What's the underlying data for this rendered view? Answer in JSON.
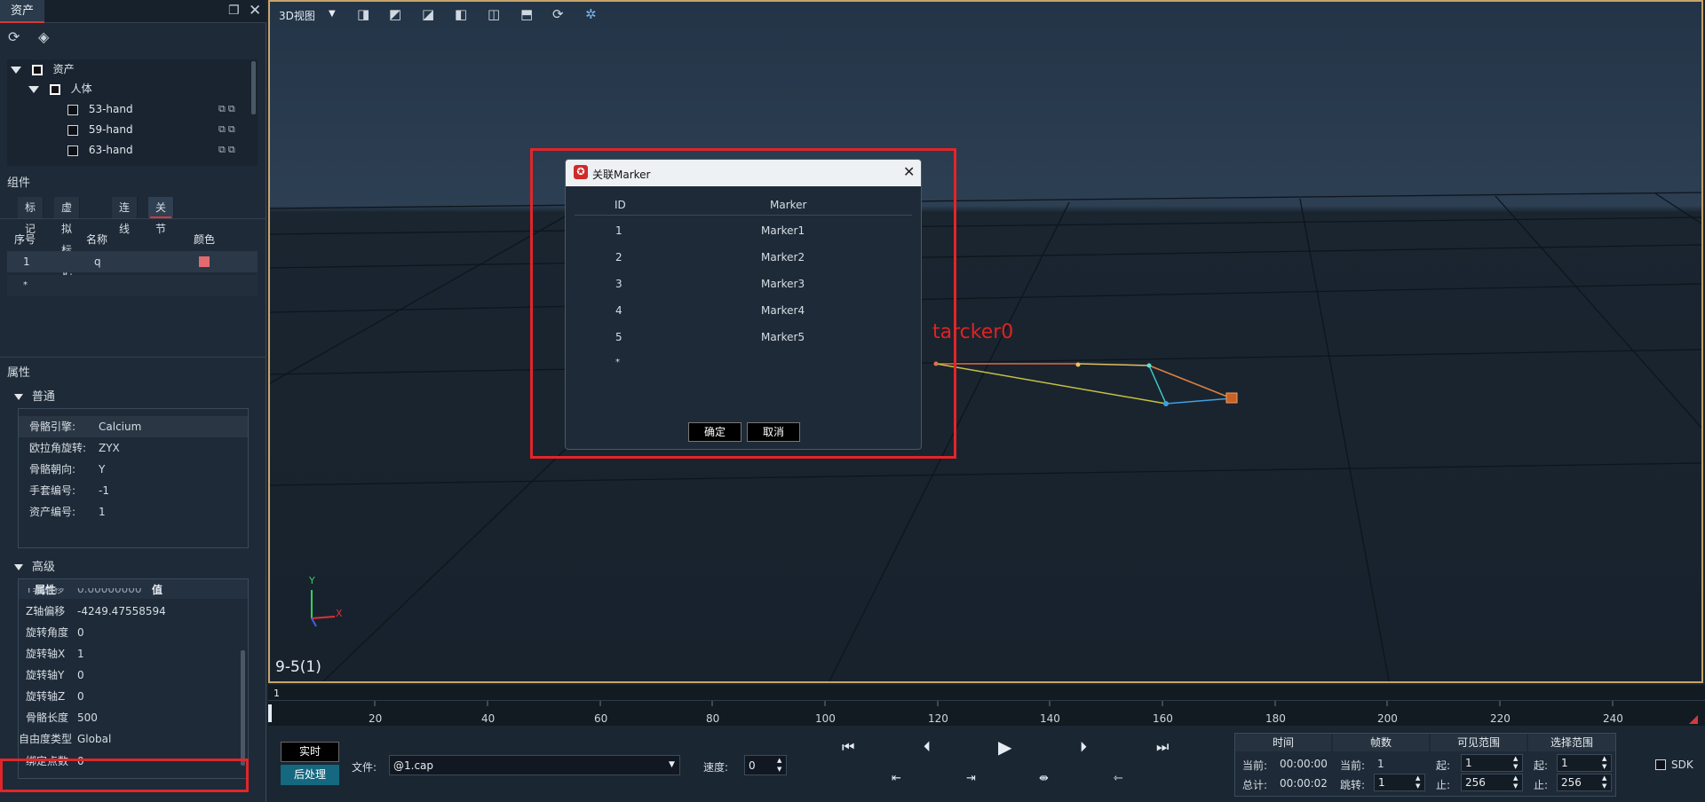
{
  "left_panel": {
    "tab_label": "资产",
    "tree": {
      "root": "资产",
      "group": "人体",
      "items": [
        "53-hand",
        "59-hand",
        "63-hand"
      ]
    },
    "components": {
      "title": "组件",
      "tabs": [
        "标记",
        "虚拟标记",
        "连线",
        "关节"
      ],
      "active_tab": "关节",
      "columns": [
        "序号",
        "名称",
        "颜色"
      ],
      "rows": [
        {
          "index": "1",
          "name": "q",
          "color": "#e46a6e"
        }
      ],
      "new_row_marker": "*"
    },
    "properties": {
      "title": "属性",
      "general_title": "普通",
      "general": [
        {
          "label": "骨骼引擎:",
          "value": "Calcium"
        },
        {
          "label": "欧拉角旋转:",
          "value": "ZYX"
        },
        {
          "label": "骨骼朝向:",
          "value": "Y"
        },
        {
          "label": "手套编号:",
          "value": "-1"
        },
        {
          "label": "资产编号:",
          "value": "1"
        }
      ],
      "advanced_title": "高级",
      "advanced_columns": [
        "属性",
        "值"
      ],
      "advanced_partial": {
        "label": "Y轴偏移",
        "value": "0.00000000"
      },
      "advanced": [
        {
          "label": "Z轴偏移",
          "value": "-4249.47558594"
        },
        {
          "label": "旋转角度",
          "value": "0"
        },
        {
          "label": "旋转轴X",
          "value": "1"
        },
        {
          "label": "旋转轴Y",
          "value": "0"
        },
        {
          "label": "旋转轴Z",
          "value": "0"
        },
        {
          "label": "骨骼长度",
          "value": "500"
        },
        {
          "label": "自由度类型",
          "value": "Global"
        },
        {
          "label": "绑定点数",
          "value": "0"
        }
      ]
    }
  },
  "viewport": {
    "view_mode": "3D视图",
    "tracker_label": "tarcker0",
    "frame_label": "9-5(1)",
    "axis_labels": {
      "x": "X",
      "y": "Y"
    }
  },
  "dialog": {
    "title": "关联Marker",
    "columns": [
      "ID",
      "Marker"
    ],
    "rows": [
      {
        "id": "1",
        "marker": "Marker1"
      },
      {
        "id": "2",
        "marker": "Marker2"
      },
      {
        "id": "3",
        "marker": "Marker3"
      },
      {
        "id": "4",
        "marker": "Marker4"
      },
      {
        "id": "5",
        "marker": "Marker5"
      }
    ],
    "new_row_marker": "*",
    "ok_label": "确定",
    "cancel_label": "取消"
  },
  "timeline": {
    "current_frame": "1",
    "ticks": [
      "20",
      "40",
      "60",
      "80",
      "100",
      "120",
      "140",
      "160",
      "180",
      "200",
      "220",
      "240"
    ]
  },
  "bottom": {
    "realtime_label": "实时",
    "postprocess_label": "后处理",
    "file_label": "文件:",
    "file_value": "@1.cap",
    "speed_label": "速度:",
    "speed_value": "0",
    "time": {
      "title": "时间",
      "current_label": "当前:",
      "current_value": "00:00:00",
      "total_label": "总计:",
      "total_value": "00:00:02"
    },
    "frames": {
      "title": "帧数",
      "current_label": "当前:",
      "current_value": "1",
      "jump_label": "跳转:",
      "jump_value": "1"
    },
    "visible": {
      "title": "可见范围",
      "start_label": "起:",
      "start_value": "1",
      "end_label": "止:",
      "end_value": "256"
    },
    "select": {
      "title": "选择范围",
      "start_label": "起:",
      "start_value": "1",
      "end_label": "止:",
      "end_value": "256"
    },
    "sdk_label": "SDK"
  }
}
